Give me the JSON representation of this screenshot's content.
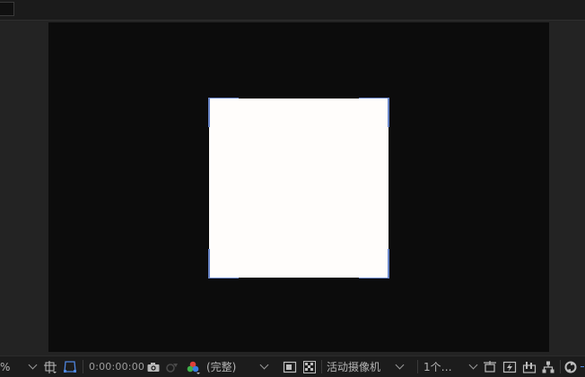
{
  "toolbar": {
    "zoom_value": "%",
    "timecode": "0:00:00:00",
    "resolution": "(完整)",
    "camera": "活动摄像机",
    "views": "1个…"
  },
  "colors": {
    "pasteboard": "#0c0c0c",
    "panel": "#232323",
    "layer": "#fffdfb",
    "selection": "#6a86c8",
    "toolbar": "#1c1c1c"
  },
  "icons": {
    "grid": "grid-guides-icon",
    "mask": "mask-boundary-icon",
    "snapshot": "camera-snapshot-icon",
    "show_snapshot": "show-snapshot-icon",
    "channels": "rgb-channels-icon",
    "region": "region-of-interest-icon",
    "transparency": "transparency-grid-icon",
    "draft3d": "draft-3d-icon",
    "fast_preview": "fast-preview-icon",
    "timeline": "timeline-icon",
    "flowchart": "flowchart-icon",
    "reset_exposure": "reset-exposure-icon"
  }
}
